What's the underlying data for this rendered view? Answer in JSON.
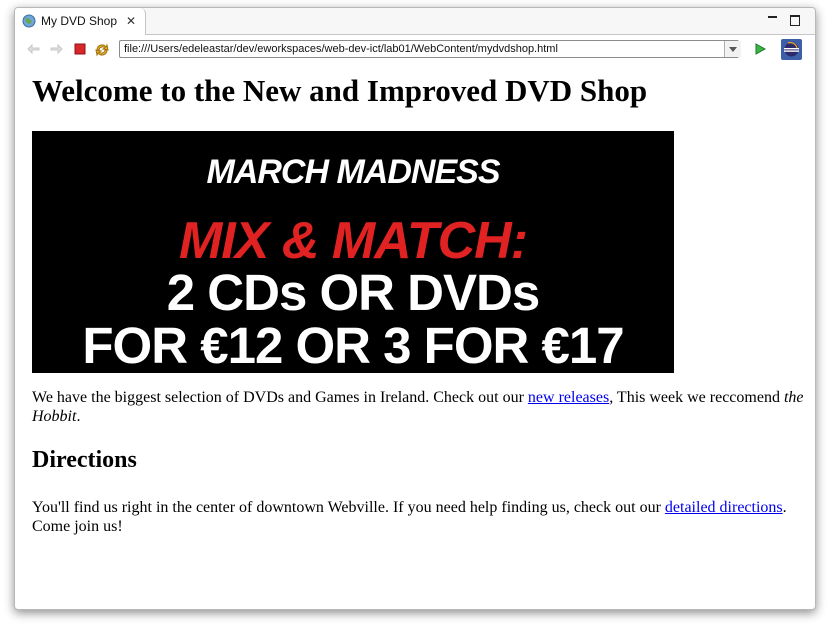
{
  "browser": {
    "tab_title": "My DVD Shop",
    "url": "file:///Users/edeleastar/dev/eworkspaces/web-dev-ict/lab01/WebContent/mydvdshop.html"
  },
  "page": {
    "heading": "Welcome to the New and Improved DVD Shop",
    "banner": {
      "line1": "MARCH MADNESS",
      "line2": "MIX & MATCH:",
      "line3": "2 CDs OR DVDs",
      "line4": "FOR €12 OR 3 FOR €17"
    },
    "intro": {
      "text_before": "We have the biggest selection of DVDs and Games in Ireland. Check out our ",
      "link": "new releases",
      "text_middle": ", This week we reccomend ",
      "emphasis": "the Hobbit",
      "text_after": "."
    },
    "directions": {
      "heading": "Directions",
      "text_before": "You'll find us right in the center of downtown Webville. If you need help finding us, check out our ",
      "link": "detailed directions",
      "text_after": ". Come join us!"
    }
  }
}
